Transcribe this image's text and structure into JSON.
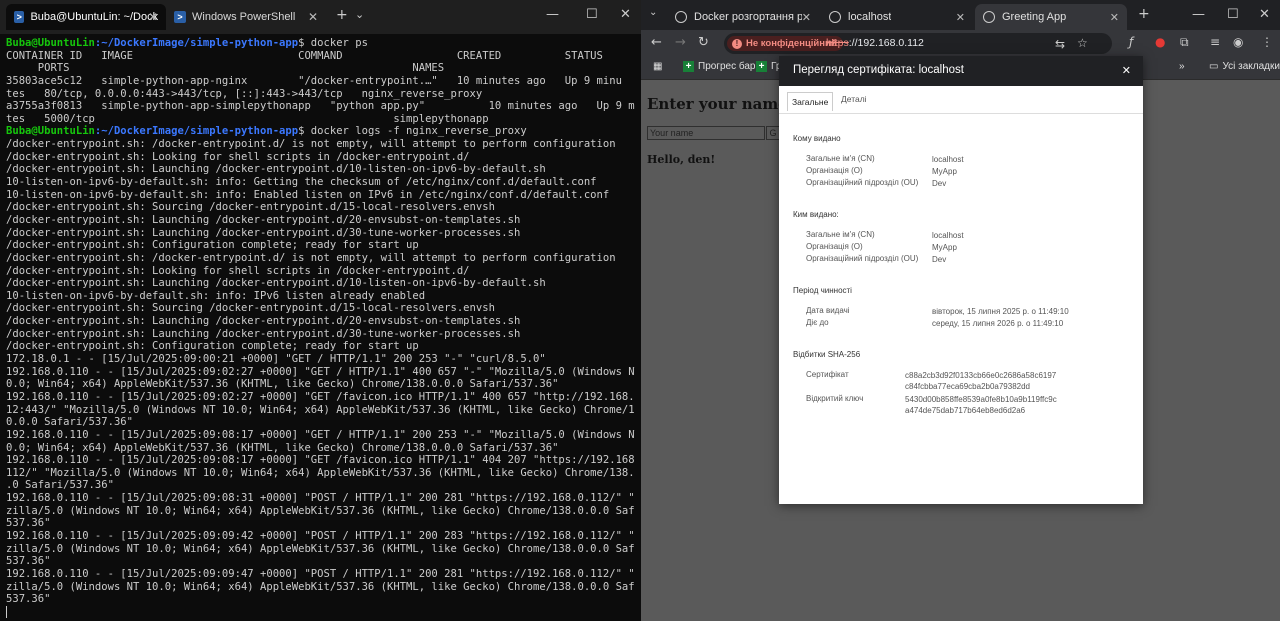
{
  "terminal": {
    "tabs": [
      {
        "label": "Buba@UbuntuLin: ~/DockerIn",
        "icon": "linux-icon"
      },
      {
        "label": "Windows PowerShell",
        "icon": "powershell-icon"
      }
    ],
    "new_tab_label": "+",
    "dropdown_label": "⌄",
    "lines": [
      {
        "type": "prompt",
        "user": "Buba@UbuntuLin",
        "path": ":~/DockerImage/simple-python-app",
        "cmd": "$ docker ps"
      },
      {
        "type": "text",
        "text": "CONTAINER ID   IMAGE                          COMMAND                  CREATED          STATUS"
      },
      {
        "type": "text",
        "text": "     PORTS                                                      NAMES"
      },
      {
        "type": "text",
        "text": "35803ace5c12   simple-python-app-nginx        \"/docker-entrypoint.…\"   10 minutes ago   Up 9 minu"
      },
      {
        "type": "text",
        "text": "tes   80/tcp, 0.0.0.0:443->443/tcp, [::]:443->443/tcp   nginx_reverse_proxy"
      },
      {
        "type": "text",
        "text": "a3755a3f0813   simple-python-app-simplepythonapp   \"python app.py\"          10 minutes ago   Up 9 minu"
      },
      {
        "type": "text",
        "text": "tes   5000/tcp                                               simplepythonapp"
      },
      {
        "type": "prompt",
        "user": "Buba@UbuntuLin",
        "path": ":~/DockerImage/simple-python-app",
        "cmd": "$ docker logs -f nginx_reverse_proxy"
      },
      {
        "type": "text",
        "text": "/docker-entrypoint.sh: /docker-entrypoint.d/ is not empty, will attempt to perform configuration"
      },
      {
        "type": "text",
        "text": "/docker-entrypoint.sh: Looking for shell scripts in /docker-entrypoint.d/"
      },
      {
        "type": "text",
        "text": "/docker-entrypoint.sh: Launching /docker-entrypoint.d/10-listen-on-ipv6-by-default.sh"
      },
      {
        "type": "text",
        "text": "10-listen-on-ipv6-by-default.sh: info: Getting the checksum of /etc/nginx/conf.d/default.conf"
      },
      {
        "type": "text",
        "text": "10-listen-on-ipv6-by-default.sh: info: Enabled listen on IPv6 in /etc/nginx/conf.d/default.conf"
      },
      {
        "type": "text",
        "text": "/docker-entrypoint.sh: Sourcing /docker-entrypoint.d/15-local-resolvers.envsh"
      },
      {
        "type": "text",
        "text": "/docker-entrypoint.sh: Launching /docker-entrypoint.d/20-envsubst-on-templates.sh"
      },
      {
        "type": "text",
        "text": "/docker-entrypoint.sh: Launching /docker-entrypoint.d/30-tune-worker-processes.sh"
      },
      {
        "type": "text",
        "text": "/docker-entrypoint.sh: Configuration complete; ready for start up"
      },
      {
        "type": "text",
        "text": "/docker-entrypoint.sh: /docker-entrypoint.d/ is not empty, will attempt to perform configuration"
      },
      {
        "type": "text",
        "text": "/docker-entrypoint.sh: Looking for shell scripts in /docker-entrypoint.d/"
      },
      {
        "type": "text",
        "text": "/docker-entrypoint.sh: Launching /docker-entrypoint.d/10-listen-on-ipv6-by-default.sh"
      },
      {
        "type": "text",
        "text": "10-listen-on-ipv6-by-default.sh: info: IPv6 listen already enabled"
      },
      {
        "type": "text",
        "text": "/docker-entrypoint.sh: Sourcing /docker-entrypoint.d/15-local-resolvers.envsh"
      },
      {
        "type": "text",
        "text": "/docker-entrypoint.sh: Launching /docker-entrypoint.d/20-envsubst-on-templates.sh"
      },
      {
        "type": "text",
        "text": "/docker-entrypoint.sh: Launching /docker-entrypoint.d/30-tune-worker-processes.sh"
      },
      {
        "type": "text",
        "text": "/docker-entrypoint.sh: Configuration complete; ready for start up"
      },
      {
        "type": "text",
        "text": "172.18.0.1 - - [15/Jul/2025:09:00:21 +0000] \"GET / HTTP/1.1\" 200 253 \"-\" \"curl/8.5.0\""
      },
      {
        "type": "text",
        "text": "192.168.0.110 - - [15/Jul/2025:09:02:27 +0000] \"GET / HTTP/1.1\" 400 657 \"-\" \"Mozilla/5.0 (Windows NT 1"
      },
      {
        "type": "text",
        "text": "0.0; Win64; x64) AppleWebKit/537.36 (KHTML, like Gecko) Chrome/138.0.0.0 Safari/537.36\""
      },
      {
        "type": "text",
        "text": "192.168.0.110 - - [15/Jul/2025:09:02:27 +0000] \"GET /favicon.ico HTTP/1.1\" 400 657 \"http://192.168.0.1"
      },
      {
        "type": "text",
        "text": "12:443/\" \"Mozilla/5.0 (Windows NT 10.0; Win64; x64) AppleWebKit/537.36 (KHTML, like Gecko) Chrome/138."
      },
      {
        "type": "text",
        "text": "0.0.0 Safari/537.36\""
      },
      {
        "type": "text",
        "text": "192.168.0.110 - - [15/Jul/2025:09:08:17 +0000] \"GET / HTTP/1.1\" 200 253 \"-\" \"Mozilla/5.0 (Windows NT 1"
      },
      {
        "type": "text",
        "text": "0.0; Win64; x64) AppleWebKit/537.36 (KHTML, like Gecko) Chrome/138.0.0.0 Safari/537.36\""
      },
      {
        "type": "text",
        "text": "192.168.0.110 - - [15/Jul/2025:09:08:17 +0000] \"GET /favicon.ico HTTP/1.1\" 404 207 \"https://192.168.0."
      },
      {
        "type": "text",
        "text": "112/\" \"Mozilla/5.0 (Windows NT 10.0; Win64; x64) AppleWebKit/537.36 (KHTML, like Gecko) Chrome/138.0.0"
      },
      {
        "type": "text",
        "text": ".0 Safari/537.36\""
      },
      {
        "type": "text",
        "text": "192.168.0.110 - - [15/Jul/2025:09:08:31 +0000] \"POST / HTTP/1.1\" 200 281 \"https://192.168.0.112/\" \"Mo"
      },
      {
        "type": "text",
        "text": "zilla/5.0 (Windows NT 10.0; Win64; x64) AppleWebKit/537.36 (KHTML, like Gecko) Chrome/138.0.0.0 Safari/"
      },
      {
        "type": "text",
        "text": "537.36\""
      },
      {
        "type": "text",
        "text": "192.168.0.110 - - [15/Jul/2025:09:09:42 +0000] \"POST / HTTP/1.1\" 200 283 \"https://192.168.0.112/\" \"Mo"
      },
      {
        "type": "text",
        "text": "zilla/5.0 (Windows NT 10.0; Win64; x64) AppleWebKit/537.36 (KHTML, like Gecko) Chrome/138.0.0.0 Safari/"
      },
      {
        "type": "text",
        "text": "537.36\""
      },
      {
        "type": "text",
        "text": "192.168.0.110 - - [15/Jul/2025:09:09:47 +0000] \"POST / HTTP/1.1\" 200 281 \"https://192.168.0.112/\" \"Mo"
      },
      {
        "type": "text",
        "text": "zilla/5.0 (Windows NT 10.0; Win64; x64) AppleWebKit/537.36 (KHTML, like Gecko) Chrome/138.0.0.0 Safari/"
      },
      {
        "type": "text",
        "text": "537.36\""
      },
      {
        "type": "cursor"
      }
    ]
  },
  "browser": {
    "tabs": [
      {
        "label": "Docker розгортання рекоме",
        "active": false
      },
      {
        "label": "localhost",
        "active": false
      },
      {
        "label": "Greeting App",
        "active": true
      }
    ],
    "not_secure_label": "Не конфіденційний",
    "url_scheme": "https",
    "url_rest": "://192.168.0.112",
    "bookmarks": [
      {
        "label": "Прогрес бар"
      },
      {
        "label": "Гр"
      }
    ],
    "all_bookmarks_label": "Усі закладки",
    "page": {
      "heading": "Enter your name:",
      "input_placeholder": "Your name",
      "button_label": "G",
      "greeting": "Hello, den!"
    },
    "cert": {
      "title": "Перегляд сертифіката: localhost",
      "tabs": [
        "Загальне",
        "Деталі"
      ],
      "issued_to_heading": "Кому видано",
      "issued_to": [
        {
          "k": "Загальне ім'я (CN)",
          "v": "localhost"
        },
        {
          "k": "Організація (O)",
          "v": "MyApp"
        },
        {
          "k": "Організаційний підрозділ (OU)",
          "v": "Dev"
        }
      ],
      "issued_by_heading": "Ким видано:",
      "issued_by": [
        {
          "k": "Загальне ім'я (CN)",
          "v": "localhost"
        },
        {
          "k": "Організація (O)",
          "v": "MyApp"
        },
        {
          "k": "Організаційний підрозділ (OU)",
          "v": "Dev"
        }
      ],
      "validity_heading": "Період чинності",
      "validity": [
        {
          "k": "Дата видачі",
          "v": "вівторок, 15 липня 2025 р. о 11:49:10"
        },
        {
          "k": "Діє до",
          "v": "середу, 15 липня 2026 р. о 11:49:10"
        }
      ],
      "fingerprints_heading": "Відбитки SHA-256",
      "fingerprints": [
        {
          "k": "Сертифікат",
          "v": "c88a2cb3d92f0133cb66e0c2686a58c6197c84fcbba77eca69cba2b0a79382dd"
        },
        {
          "k": "Відкритий ключ",
          "v": "5430d00b858ffe8539a0fe8b10a9b119ffc9ca474de75dab717b64eb8ed6d2a6"
        }
      ]
    }
  }
}
